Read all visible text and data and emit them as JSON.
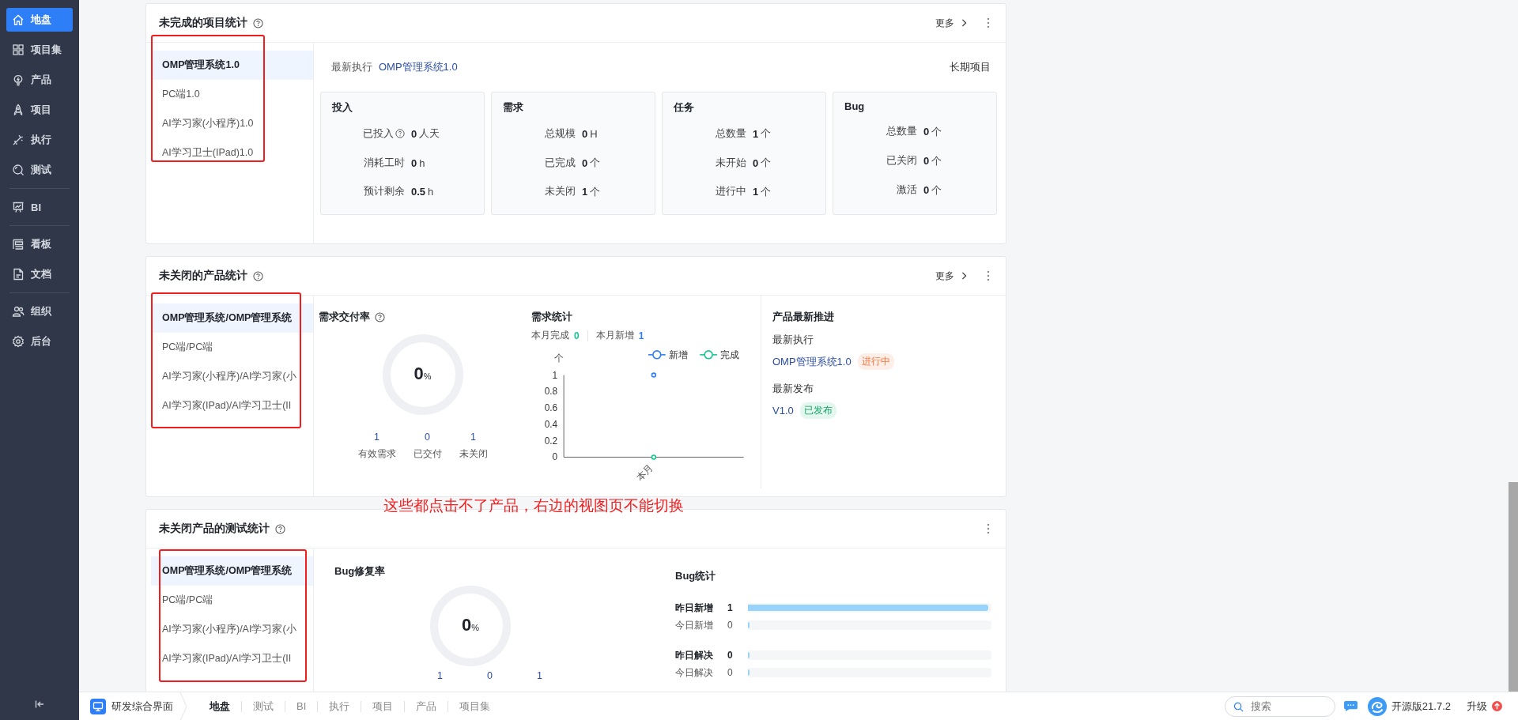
{
  "sidebar": {
    "groups": [
      [
        {
          "label": "地盘",
          "selected": true
        },
        {
          "label": "项目集",
          "selected": false
        },
        {
          "label": "产品",
          "selected": false
        },
        {
          "label": "项目",
          "selected": false
        },
        {
          "label": "执行",
          "selected": false
        },
        {
          "label": "测试",
          "selected": false
        }
      ],
      [
        {
          "label": "BI",
          "selected": false
        }
      ],
      [
        {
          "label": "看板",
          "selected": false
        },
        {
          "label": "文档",
          "selected": false
        }
      ],
      [
        {
          "label": "组织",
          "selected": false
        },
        {
          "label": "后台",
          "selected": false
        }
      ]
    ]
  },
  "project_card": {
    "title": "未完成的项目统计",
    "more": "更多",
    "highlighted": true,
    "list": [
      {
        "label": "OMP管理系统1.0",
        "selected": true
      },
      {
        "label": "PC端1.0",
        "selected": false
      },
      {
        "label": "AI学习家(小程序)1.0",
        "selected": false
      },
      {
        "label": "AI学习卫士(IPad)1.0",
        "selected": false
      }
    ],
    "latest_label": "最新执行",
    "latest_value": "OMP管理系统1.0",
    "type": "长期项目",
    "stats": [
      {
        "title": "投入",
        "rows": [
          {
            "label": "已投入",
            "help": true,
            "value": "0",
            "unit": "人天"
          },
          {
            "label": "消耗工时",
            "help": false,
            "value": "0",
            "unit": "h"
          },
          {
            "label": "预计剩余",
            "help": false,
            "value": "0.5",
            "unit": "h"
          }
        ]
      },
      {
        "title": "需求",
        "rows": [
          {
            "label": "总规模",
            "help": false,
            "value": "0",
            "unit": "H"
          },
          {
            "label": "已完成",
            "help": false,
            "value": "0",
            "unit": "个"
          },
          {
            "label": "未关闭",
            "help": false,
            "value": "1",
            "unit": "个"
          }
        ]
      },
      {
        "title": "任务",
        "rows": [
          {
            "label": "总数量",
            "help": false,
            "value": "1",
            "unit": "个"
          },
          {
            "label": "未开始",
            "help": false,
            "value": "0",
            "unit": "个"
          },
          {
            "label": "进行中",
            "help": false,
            "value": "1",
            "unit": "个"
          }
        ]
      },
      {
        "title": "Bug",
        "rows": [
          {
            "label": "总数量",
            "help": false,
            "value": "0",
            "unit": "个"
          },
          {
            "label": "已关闭",
            "help": false,
            "value": "0",
            "unit": "个"
          },
          {
            "label": "激活",
            "help": false,
            "value": "0",
            "unit": "个"
          }
        ]
      }
    ]
  },
  "product_card": {
    "title": "未关闭的产品统计",
    "more": "更多",
    "highlighted": true,
    "list": [
      {
        "label": "OMP管理系统/OMP管理系统",
        "selected": true
      },
      {
        "label": "PC端/PC端",
        "selected": false
      },
      {
        "label": "AI学习家(小程序)/AI学习家(小",
        "selected": false
      },
      {
        "label": "AI学习家(IPad)/AI学习卫士(II",
        "selected": false
      }
    ],
    "delivery": {
      "title": "需求交付率",
      "percent": "0",
      "unit": "%",
      "counts": [
        {
          "value": "1",
          "label": "有效需求"
        },
        {
          "value": "0",
          "label": "已交付"
        },
        {
          "value": "1",
          "label": "未关闭"
        }
      ]
    },
    "demand": {
      "title": "需求统计",
      "summary": [
        {
          "label": "本月完成",
          "value": "0",
          "color": "#17c68e"
        },
        {
          "label": "本月新增",
          "value": "1",
          "color": "#2e7ff7"
        }
      ],
      "chart_data": {
        "type": "line",
        "ylabel": "个",
        "legend": "top-right",
        "categories": [
          "本月"
        ],
        "series": [
          {
            "name": "新增",
            "color": "#2e7ff7",
            "marker": "circle",
            "values": [
              1
            ]
          },
          {
            "name": "完成",
            "color": "#17c68e",
            "marker": "circle",
            "values": [
              0
            ]
          }
        ],
        "ylim": [
          0,
          1
        ],
        "yticks": [
          0,
          0.2,
          0.4,
          0.6,
          0.8,
          1
        ]
      }
    },
    "progress": {
      "title": "产品最新推进",
      "sections": [
        {
          "label": "最新执行",
          "name": "OMP管理系统1.0",
          "tag": "进行中",
          "kind": "running"
        },
        {
          "label": "最新发布",
          "name": "V1.0",
          "tag": "已发布",
          "kind": "released"
        }
      ]
    }
  },
  "note": "这些都点击不了产品，右边的视图页不能切换",
  "test_card": {
    "title": "未关闭产品的测试统计",
    "highlighted": true,
    "list": [
      {
        "label": "OMP管理系统/OMP管理系统",
        "selected": true
      },
      {
        "label": "PC端/PC端",
        "selected": false
      },
      {
        "label": "AI学习家(小程序)/AI学习家(小",
        "selected": false
      },
      {
        "label": "AI学习家(IPad)/AI学习卫士(II",
        "selected": false
      }
    ],
    "fix_rate": {
      "title": "Bug修复率",
      "percent": "0",
      "unit": "%",
      "counts": [
        "1",
        "0",
        "1"
      ]
    },
    "bug_stats": {
      "title": "Bug统计",
      "rows": [
        {
          "label": "昨日新增",
          "value": "1",
          "emphasis": true,
          "level": 1
        },
        {
          "label": "今日新增",
          "value": "0",
          "emphasis": false,
          "level": 0
        },
        {
          "label": "昨日解决",
          "value": "0",
          "emphasis": true,
          "level": 0
        },
        {
          "label": "今日解决",
          "value": "0",
          "emphasis": false,
          "level": 0
        }
      ]
    }
  },
  "bottom_bar": {
    "app": "研发综合界面",
    "tabs": [
      {
        "label": "地盘",
        "selected": true
      },
      {
        "label": "测试",
        "selected": false
      },
      {
        "label": "BI",
        "selected": false
      },
      {
        "label": "执行",
        "selected": false
      },
      {
        "label": "项目",
        "selected": false
      },
      {
        "label": "产品",
        "selected": false
      },
      {
        "label": "项目集",
        "selected": false
      }
    ],
    "search": {
      "placeholder": "搜索"
    },
    "version": "开源版21.7.2",
    "upgrade": "升级"
  }
}
